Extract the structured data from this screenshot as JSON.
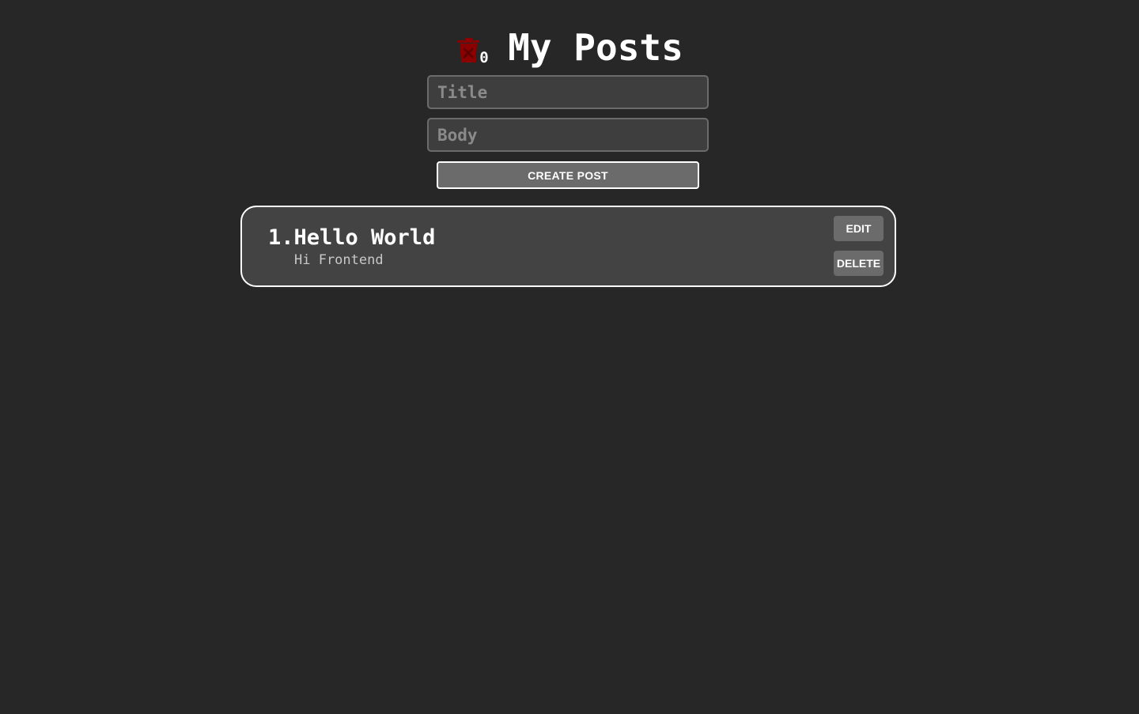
{
  "header": {
    "title": "My Posts",
    "trash_count": "0",
    "trash_icon": "trash-icon",
    "trash_color": "#8b0000"
  },
  "form": {
    "title_placeholder": "Title",
    "title_value": "",
    "body_placeholder": "Body",
    "body_value": "",
    "create_label": "Create post"
  },
  "posts": [
    {
      "title": "1.Hello World",
      "body": "Hi Frontend",
      "edit_label": "Edit",
      "delete_label": "Delete"
    }
  ],
  "colors": {
    "background": "#272727",
    "card": "#434343",
    "button": "#6b6b6b",
    "text": "#ffffff"
  }
}
